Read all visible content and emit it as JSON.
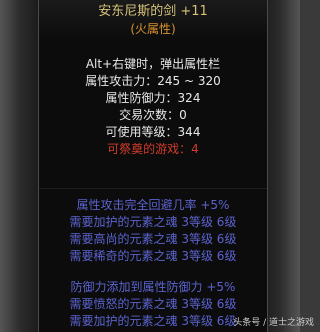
{
  "tooltip": {
    "item_name": "安东尼斯的剑 +11",
    "element_tag": "(火属性)",
    "hint": "Alt+右键时，弹出属性栏",
    "stats": [
      "属性攻击力：245 ~ 320",
      "属性防御力：324",
      "交易次数：0",
      "可使用等级：344"
    ],
    "sacrifice": "可祭奠的游戏：4",
    "attack_section": {
      "title": "属性攻击完全回避几率 +5%",
      "requirements": [
        "需要加护的元素之魂 3等级 6级",
        "需要高尚的元素之魂 3等级 6级",
        "需要稀奇的元素之魂 3等级 6级"
      ]
    },
    "defense_section": {
      "title": "防御力添加到属性防御力 +5%",
      "requirements": [
        "需要愤怒的元素之魂 3等级 6级",
        "需要加护的元素之魂 3等级 6级",
        "需要..的元素之魂 3等级 6级"
      ]
    }
  },
  "watermark": "头条号 / 道士之游戏",
  "colors": {
    "name": "#d6c27a",
    "tag": "#d8922c",
    "text": "#e8e8e8",
    "warning": "#d23b2b",
    "requirement": "#5b63cf"
  }
}
